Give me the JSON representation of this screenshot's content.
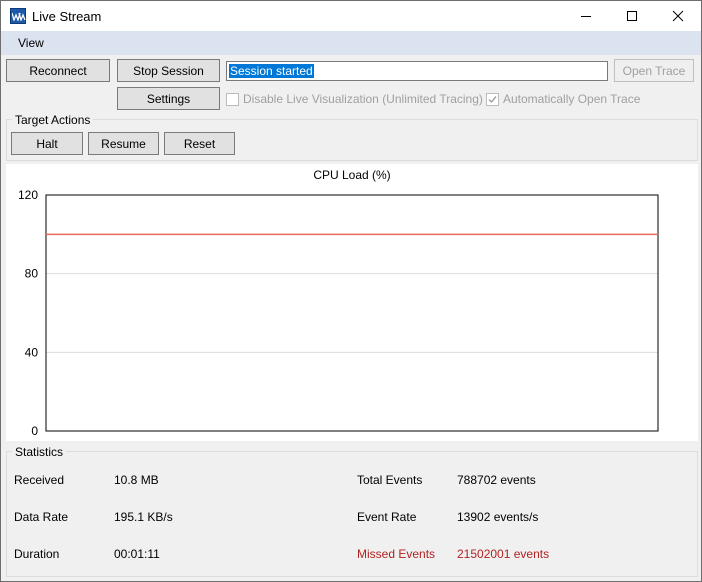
{
  "window": {
    "title": "Live Stream"
  },
  "menu": {
    "items": [
      {
        "label": "View"
      }
    ]
  },
  "toolbar": {
    "reconnect_label": "Reconnect",
    "stop_session_label": "Stop Session",
    "status_value": "Session started",
    "open_trace_label": "Open Trace",
    "settings_label": "Settings",
    "disable_visualization_label": "Disable Live Visualization (Unlimited Tracing)",
    "disable_visualization_checked": false,
    "auto_open_trace_label": "Automatically Open Trace",
    "auto_open_trace_checked": true
  },
  "target_actions": {
    "label": "Target Actions",
    "halt_label": "Halt",
    "resume_label": "Resume",
    "reset_label": "Reset"
  },
  "chart_data": {
    "type": "line",
    "title": "CPU Load (%)",
    "xlabel": "",
    "ylabel": "",
    "ylim": [
      0,
      120
    ],
    "yticks": [
      0,
      40,
      80,
      120
    ],
    "grid": true,
    "series": [
      {
        "color": "#e8665f",
        "x": [
          0,
          1
        ],
        "values": [
          100,
          100
        ]
      }
    ]
  },
  "statistics": {
    "label": "Statistics",
    "received_label": "Received",
    "received_value": "10.8 MB",
    "data_rate_label": "Data Rate",
    "data_rate_value": "195.1 KB/s",
    "duration_label": "Duration",
    "duration_value": "00:01:11",
    "total_events_label": "Total Events",
    "total_events_value": "788702 events",
    "event_rate_label": "Event Rate",
    "event_rate_value": "13902 events/s",
    "missed_events_label": "Missed Events",
    "missed_events_value": "21502001 events",
    "missed_color": "#b22222"
  }
}
